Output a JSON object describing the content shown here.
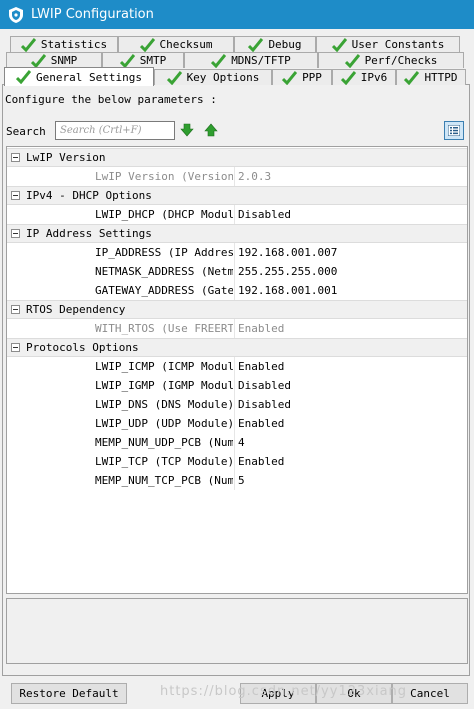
{
  "window": {
    "title": "LWIP Configuration"
  },
  "tabs": {
    "row1": [
      {
        "label": "Statistics",
        "checked": true
      },
      {
        "label": "Checksum",
        "checked": true
      },
      {
        "label": "Debug",
        "checked": true
      },
      {
        "label": "User Constants",
        "checked": true
      }
    ],
    "row2": [
      {
        "label": "SNMP",
        "checked": true
      },
      {
        "label": "SMTP",
        "checked": true
      },
      {
        "label": "MDNS/TFTP",
        "checked": true
      },
      {
        "label": "Perf/Checks",
        "checked": true
      }
    ],
    "row3": [
      {
        "label": "General Settings",
        "checked": true,
        "active": true
      },
      {
        "label": "Key Options",
        "checked": true
      },
      {
        "label": "PPP",
        "checked": true
      },
      {
        "label": "IPv6",
        "checked": true
      },
      {
        "label": "HTTPD",
        "checked": true
      }
    ]
  },
  "main": {
    "instructions": "Configure the below parameters :",
    "search_label": "Search :",
    "search_placeholder": "Search (Crtl+F)",
    "search_value": ""
  },
  "groups": [
    {
      "label": "LwIP Version",
      "params": [
        {
          "name": "LwIP Version (Version...",
          "value": "2.0.3",
          "disabled": true
        }
      ]
    },
    {
      "label": "IPv4 - DHCP Options",
      "params": [
        {
          "name": "LWIP_DHCP (DHCP Module)",
          "value": "Disabled",
          "disabled": false
        }
      ]
    },
    {
      "label": "IP Address Settings",
      "params": [
        {
          "name": "IP_ADDRESS (IP Address)",
          "value": "192.168.001.007",
          "disabled": false
        },
        {
          "name": "NETMASK_ADDRESS (Netm...",
          "value": "255.255.255.000",
          "disabled": false
        },
        {
          "name": "GATEWAY_ADDRESS (Gate...",
          "value": "192.168.001.001",
          "disabled": false
        }
      ]
    },
    {
      "label": "RTOS Dependency",
      "params": [
        {
          "name": "WITH_RTOS (Use FREERT...",
          "value": "Enabled",
          "disabled": true
        }
      ]
    },
    {
      "label": "Protocols Options",
      "params": [
        {
          "name": "LWIP_ICMP (ICMP Modul...",
          "value": "Enabled",
          "disabled": false
        },
        {
          "name": "LWIP_IGMP (IGMP Module)",
          "value": "Disabled",
          "disabled": false
        },
        {
          "name": "LWIP_DNS (DNS Module)",
          "value": "Disabled",
          "disabled": false
        },
        {
          "name": "LWIP_UDP (UDP Module)",
          "value": "Enabled",
          "disabled": false
        },
        {
          "name": "MEMP_NUM_UDP_PCB (Num...",
          "value": "4",
          "disabled": false
        },
        {
          "name": "LWIP_TCP (TCP Module)",
          "value": "Enabled",
          "disabled": false
        },
        {
          "name": "MEMP_NUM_TCP_PCB (Num...",
          "value": "5",
          "disabled": false
        }
      ]
    }
  ],
  "buttons": {
    "restore": "Restore Default",
    "apply": "Apply",
    "ok": "Ok",
    "cancel": "Cancel"
  },
  "watermark": "https://blog.csdn.net/yy123xiang",
  "colors": {
    "titlebar": "#1e8cc8",
    "check_green": "#3aa335",
    "arrow_green": "#2f9e2f",
    "disabled_text": "#8c8c8c"
  },
  "icons": {
    "tab_check": "check-mark-icon",
    "app": "shield-icon",
    "arrow_down": "arrow-down-icon",
    "arrow_up": "arrow-up-icon",
    "view": "list-view-icon"
  }
}
